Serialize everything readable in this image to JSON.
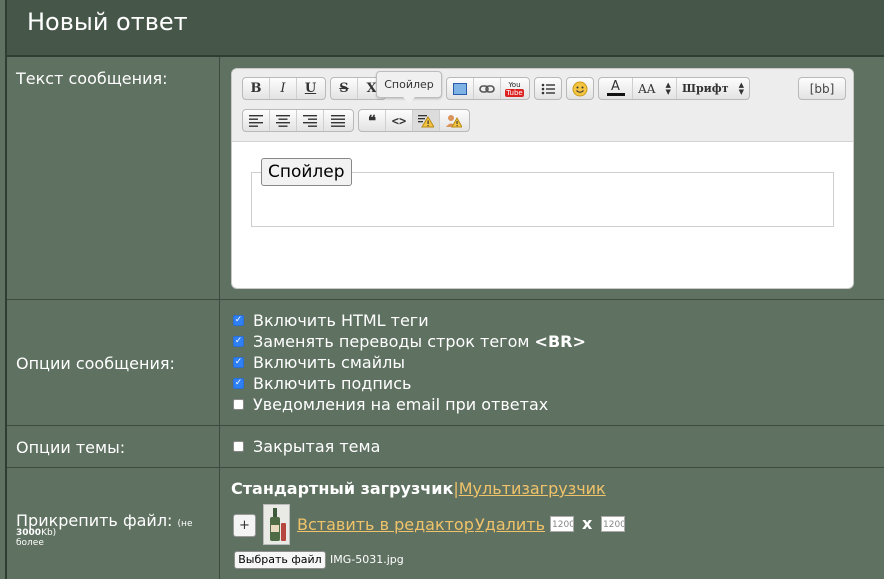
{
  "header": {
    "title": "Новый ответ"
  },
  "labels": {
    "message_text": "Текст сообщения:",
    "message_options": "Опции сообщения:",
    "topic_options": "Опции темы:",
    "attach_file": "Прикрепить файл:",
    "attach_hint_pre": "(не более ",
    "attach_hint_size": "3000",
    "attach_hint_post": "Kb)"
  },
  "toolbar": {
    "bold": "B",
    "italic": "I",
    "underline": "U",
    "strike": "S",
    "sub": "X",
    "youtube_top": "You",
    "youtube_bottom": "Tube",
    "font_size": "AA",
    "font_family": "Шрифт",
    "bb": "[bb]",
    "quote": "❝",
    "code": "<>"
  },
  "tooltip": "Спойлер",
  "editor": {
    "spoiler_legend": "Спойлер"
  },
  "message_options": [
    {
      "label": "Включить HTML теги",
      "checked": true
    },
    {
      "label": "Заменять переводы строк тегом ",
      "bold": "<BR>",
      "checked": true
    },
    {
      "label": "Включить смайлы",
      "checked": true
    },
    {
      "label": "Включить подпись",
      "checked": true
    },
    {
      "label": "Уведомления на email при ответах",
      "checked": false
    }
  ],
  "topic_option": {
    "label": "Закрытая тема",
    "checked": false
  },
  "uploader": {
    "standard": "Стандартный загрузчик",
    "separator": "|",
    "multi": "Мультизагрузчик",
    "add": "+",
    "insert": "Вставить в редактор",
    "delete": "Удалить",
    "width_value": "1200",
    "times": "x",
    "height_value": "1200",
    "choose_file": "Выбрать файл",
    "file_name": "IMG-5031.jpg"
  }
}
